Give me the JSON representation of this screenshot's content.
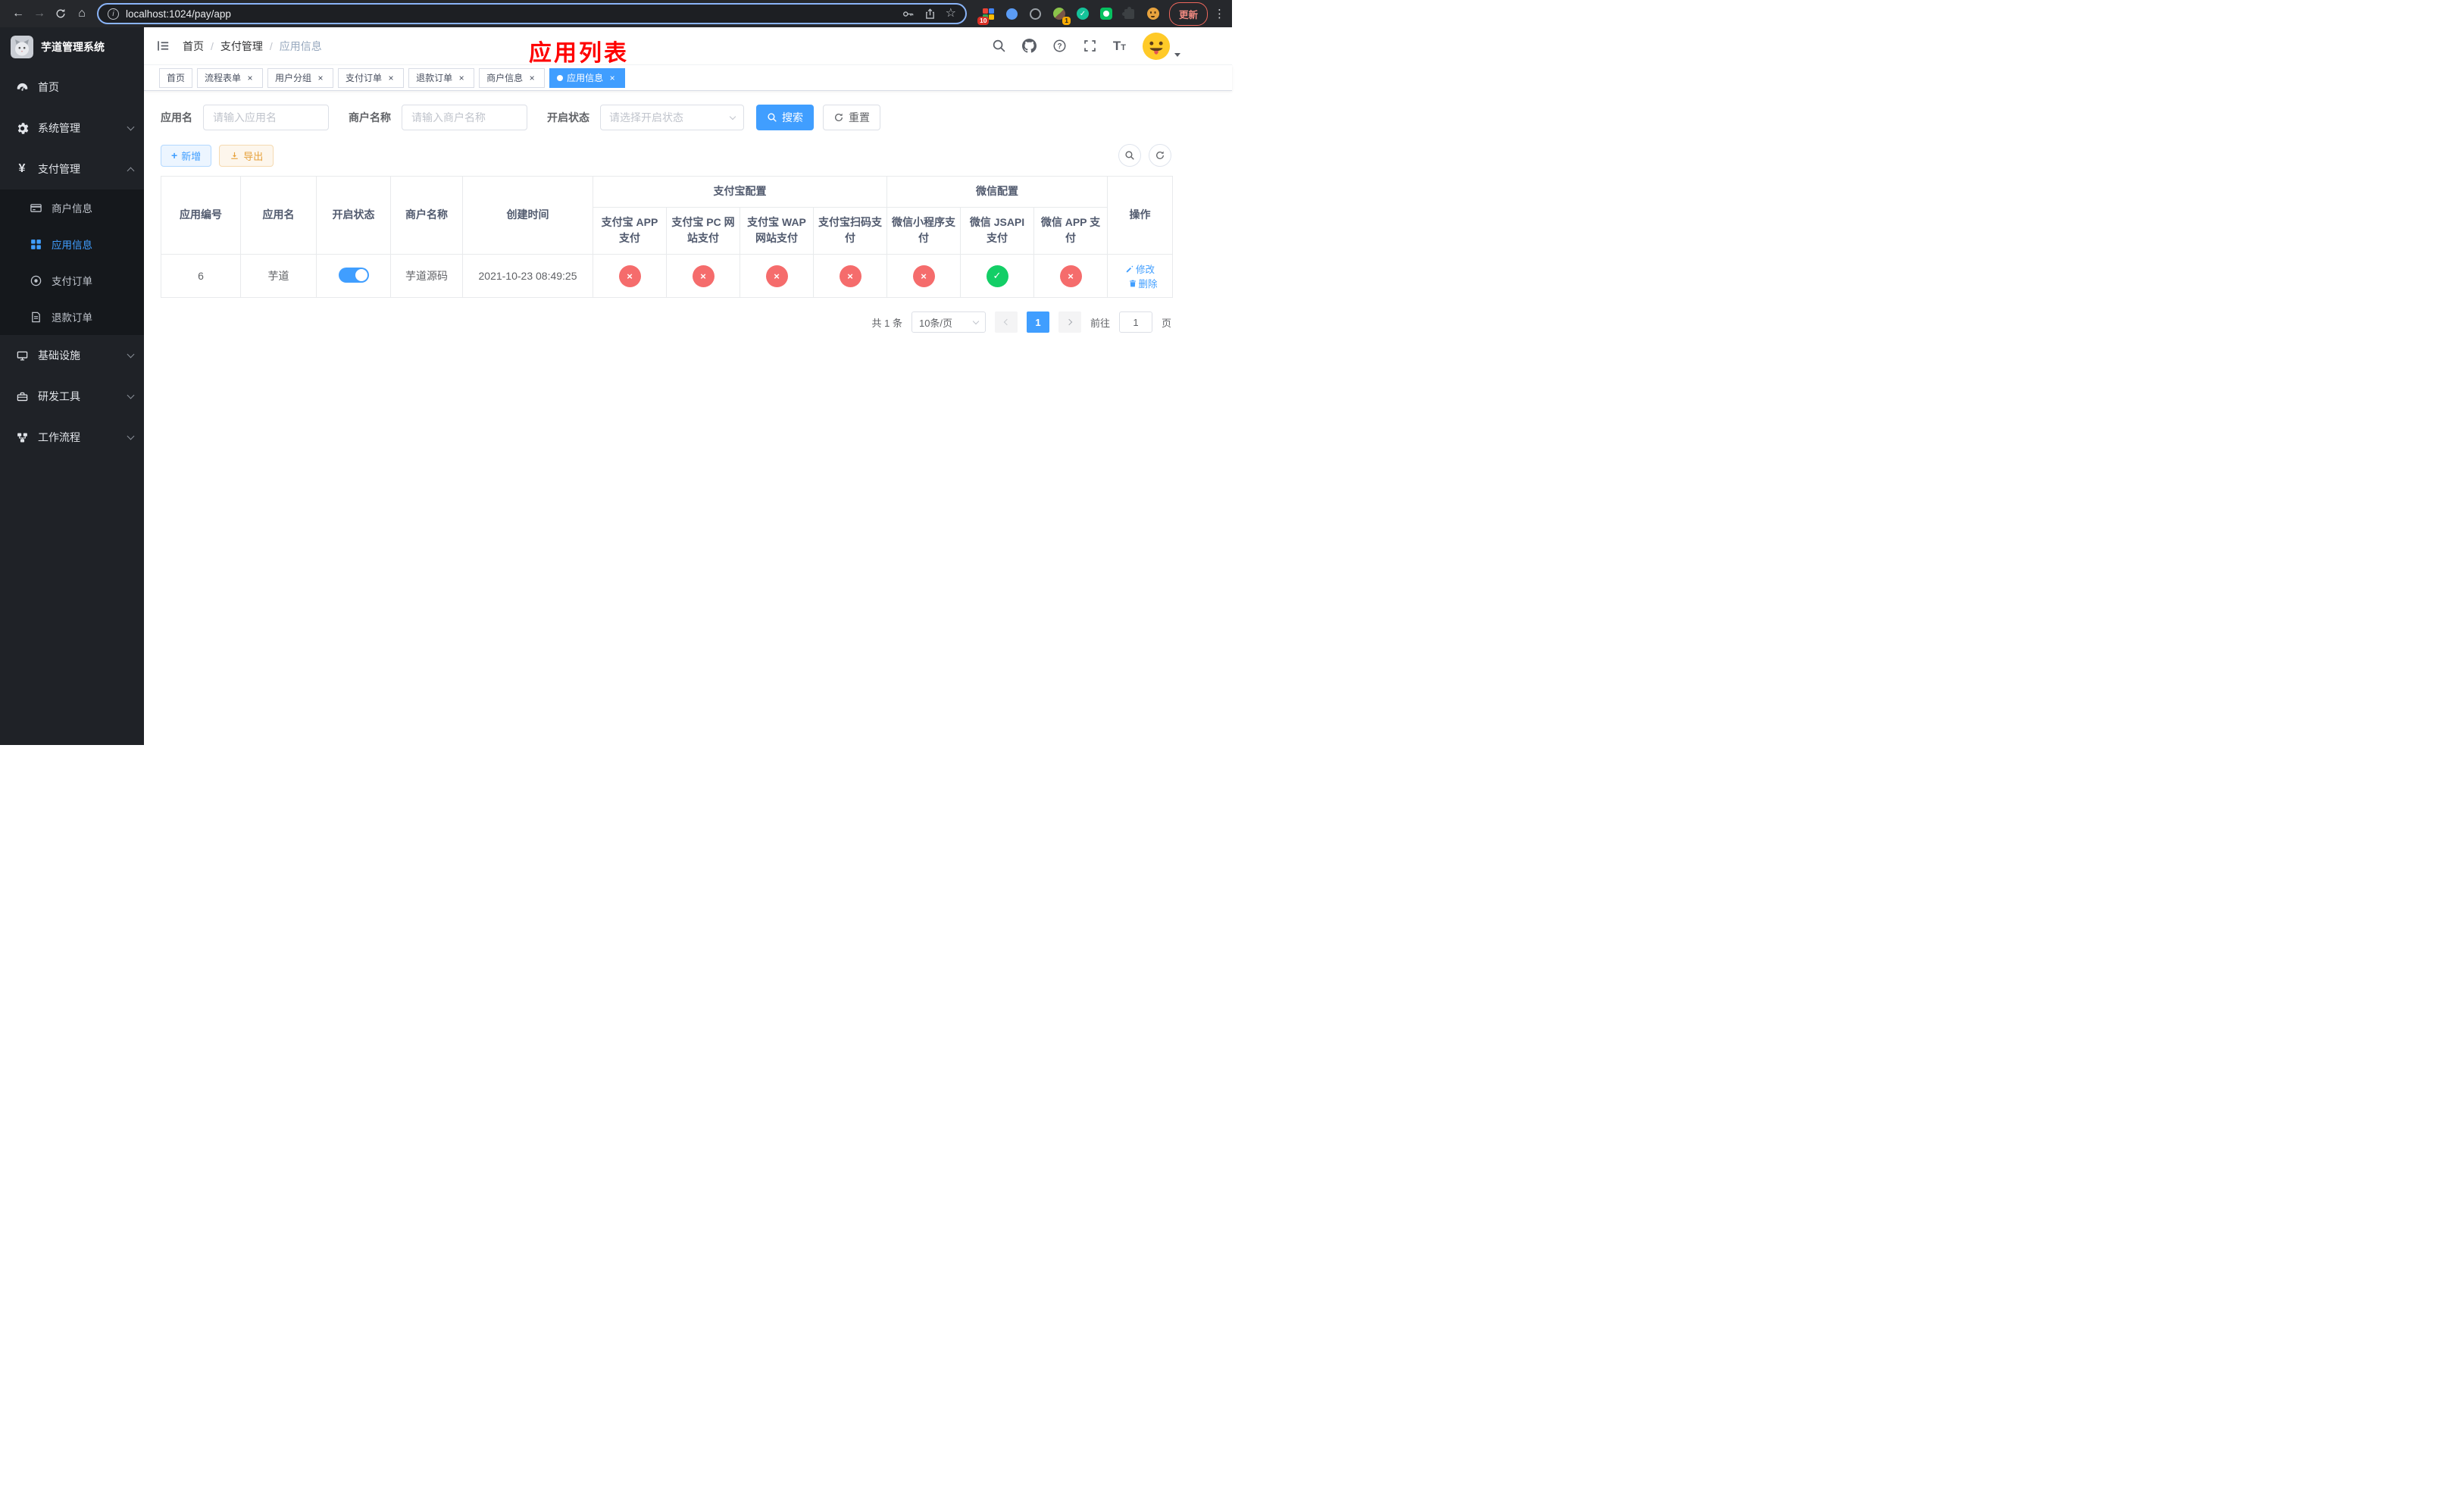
{
  "colors": {
    "accent": "#409eff",
    "success": "#13ce66",
    "danger": "#f56c6c",
    "warning": "#e6a23c",
    "annotation": "#ff0000",
    "sidebar_bg": "#1f2227"
  },
  "icons": {
    "back": "←",
    "forward": "→",
    "home": "⌂",
    "info": "i",
    "star": "☆",
    "kebab": "⋮",
    "close": "×",
    "plus": "+",
    "yen": "¥",
    "question": "?",
    "check": "✓",
    "cross": "×",
    "font_large": "T",
    "font_small": "T"
  },
  "browser": {
    "url": "localhost:1024/pay/app",
    "update_button": "更新",
    "extension_badge_count": "10",
    "profile_badge_count": "1"
  },
  "sidebar": {
    "logo_title": "芋道管理系统",
    "items": [
      {
        "label": "首页"
      },
      {
        "label": "系统管理"
      },
      {
        "label": "支付管理"
      },
      {
        "label": "基础设施"
      },
      {
        "label": "研发工具"
      },
      {
        "label": "工作流程"
      }
    ],
    "payment_children": [
      {
        "label": "商户信息"
      },
      {
        "label": "应用信息"
      },
      {
        "label": "支付订单"
      },
      {
        "label": "退款订单"
      }
    ]
  },
  "header": {
    "breadcrumb": [
      "首页",
      "支付管理",
      "应用信息"
    ],
    "breadcrumb_separator": "/",
    "annotation": "应用列表"
  },
  "tabs": [
    {
      "label": "首页"
    },
    {
      "label": "流程表单"
    },
    {
      "label": "用户分组"
    },
    {
      "label": "支付订单"
    },
    {
      "label": "退款订单"
    },
    {
      "label": "商户信息"
    },
    {
      "label": "应用信息"
    }
  ],
  "filters": {
    "app_name_label": "应用名",
    "app_name_placeholder": "请输入应用名",
    "merchant_label": "商户名称",
    "merchant_placeholder": "请输入商户名称",
    "status_label": "开启状态",
    "status_placeholder": "请选择开启状态",
    "search_button": "搜索",
    "reset_button": "重置"
  },
  "toolbar": {
    "add_button": "新增",
    "export_button": "导出"
  },
  "table": {
    "columns": [
      "应用编号",
      "应用名",
      "开启状态",
      "商户名称",
      "创建时间"
    ],
    "groups": [
      {
        "label": "支付宝配置",
        "children": [
          "支付宝 APP 支付",
          "支付宝 PC 网站支付",
          "支付宝 WAP 网站支付",
          "支付宝扫码支付"
        ]
      },
      {
        "label": "微信配置",
        "children": [
          "微信小程序支付",
          "微信 JSAPI 支付",
          "微信 APP 支付"
        ]
      }
    ],
    "actions_column": "操作",
    "rows": [
      {
        "id": "6",
        "name": "芋道",
        "enabled": true,
        "merchant": "芋道源码",
        "created": "2021-10-23 08:49:25",
        "alipay_app": false,
        "alipay_pc": false,
        "alipay_wap": false,
        "alipay_qr": false,
        "wechat_mini": false,
        "wechat_jsapi": true,
        "wechat_app": false,
        "edit_label": "修改",
        "delete_label": "删除"
      }
    ]
  },
  "pagination": {
    "total_text": "共 1 条",
    "page_size_text": "10条/页",
    "current_page": "1",
    "goto_prefix": "前往",
    "goto_value": "1",
    "goto_suffix": "页"
  }
}
